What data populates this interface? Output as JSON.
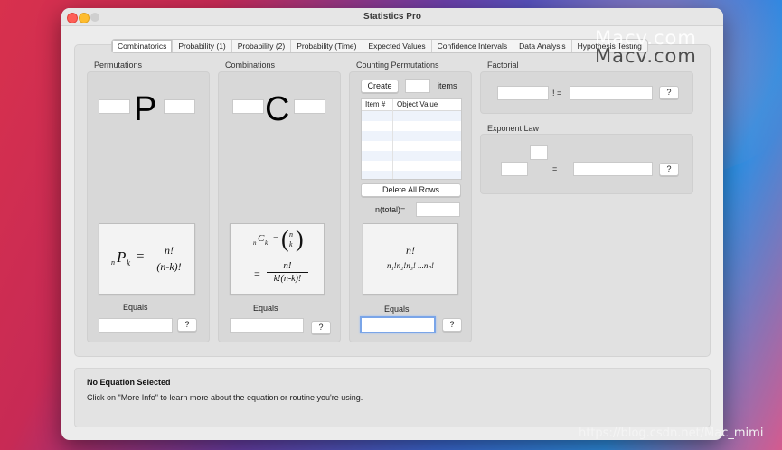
{
  "window": {
    "title": "Statistics Pro"
  },
  "tabs": [
    {
      "label": "Combinatorics",
      "active": true
    },
    {
      "label": "Probability (1)"
    },
    {
      "label": "Probability (2)"
    },
    {
      "label": "Probability (Time)"
    },
    {
      "label": "Expected Values"
    },
    {
      "label": "Confidence Intervals"
    },
    {
      "label": "Data Analysis"
    },
    {
      "label": "Hypothesis Testing"
    }
  ],
  "permutations": {
    "label": "Permutations",
    "symbol": "P",
    "formula": {
      "lhs_left_sub": "n",
      "lhs_main": "P",
      "lhs_right_sub": "k",
      "eq": "=",
      "numerator": "n!",
      "denominator": "(n-k)!"
    },
    "equals_label": "Equals",
    "help": "?"
  },
  "combinations": {
    "label": "Combinations",
    "symbol": "C",
    "formula": {
      "lhs_left_sub": "n",
      "lhs_main": "C",
      "lhs_right_sub": "k",
      "eq1": "=",
      "binom_top": "n",
      "binom_bottom": "k",
      "eq2": "=",
      "numerator": "n!",
      "denominator": "k!(n-k)!"
    },
    "equals_label": "Equals",
    "help": "?"
  },
  "counting": {
    "label": "Counting Permutations",
    "create": "Create",
    "items": "items",
    "columns": [
      "Item #",
      "Object Value"
    ],
    "delete_all": "Delete All Rows",
    "ntotal_label": "n(total)=",
    "formula": {
      "numerator": "n!",
      "denominator": "n₁!n₂!n₃! ...nₙ!"
    },
    "equals_label": "Equals",
    "help": "?"
  },
  "factorial": {
    "label": "Factorial",
    "op": "! =",
    "help": "?"
  },
  "exponent": {
    "label": "Exponent Law",
    "op": "=",
    "help": "?"
  },
  "info": {
    "title": "No Equation Selected",
    "text": "Click on \"More Info\" to learn more about the equation or routine you're using."
  },
  "watermark": {
    "top": "Macv.com",
    "bottom": "https://blog.csdn.net/Mac_mimi"
  }
}
